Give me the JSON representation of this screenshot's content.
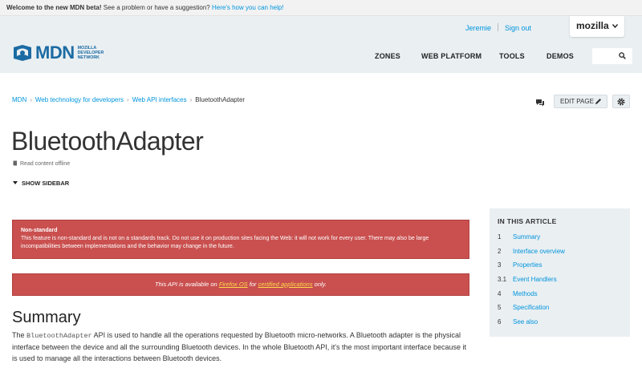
{
  "beta_bar": {
    "welcome": "Welcome to the new MDN beta!",
    "prompt": "See a problem or have a suggestion?",
    "link": "Here's how you can help!"
  },
  "header": {
    "logo_text": "MDN",
    "logo_subtitle": [
      "MOZILLA",
      "DEVELOPER",
      "NETWORK"
    ],
    "user": "Jeremie",
    "sign_out": "Sign out",
    "mozilla_tab": "mozilla",
    "nav": [
      {
        "label": "ZONES"
      },
      {
        "label": "WEB PLATFORM"
      },
      {
        "label": "TOOLS"
      },
      {
        "label": "DEMOS"
      }
    ],
    "search_placeholder": ""
  },
  "breadcrumb": {
    "items": [
      "MDN",
      "Web technology for developers",
      "Web API interfaces"
    ],
    "current": "BluetoothAdapter"
  },
  "actions": {
    "edit_label": "EDIT PAGE"
  },
  "page": {
    "title": "BluetoothAdapter",
    "offline_label": "Read content offline",
    "sidebar_toggle": "SHOW SIDEBAR"
  },
  "notice": {
    "title": "Non-standard",
    "body": "This feature is non-standard and is not on a standards track. Do not use it on production sites facing the Web: it will not work for every user. There may also be large incompatibilities between implementations and the behavior may change in the future."
  },
  "firefox_notice": {
    "pre": "This API is available on",
    "link1": "Firefox OS",
    "mid": "for",
    "link2": "certified applications",
    "post": "only."
  },
  "summary": {
    "heading": "Summary",
    "text_pre": "The",
    "code": "BluetoothAdapter",
    "text_post": "API is used to handle all the operations requested by Bluetooth micro-networks. A Bluetooth adapter is the physical interface between the device and all the surrounding Bluetooth devices. In the whole Bluetooth API, it's the most important interface because it is used to manage all the interactions between Bluetooth devices."
  },
  "toc": {
    "title": "IN THIS ARTICLE",
    "items": [
      {
        "num": "1",
        "label": "Summary"
      },
      {
        "num": "2",
        "label": "Interface overview"
      },
      {
        "num": "3",
        "label": "Properties"
      },
      {
        "num": "3.1",
        "label": "Event Handlers"
      },
      {
        "num": "4",
        "label": "Methods"
      },
      {
        "num": "5",
        "label": "Specification"
      },
      {
        "num": "6",
        "label": "See also"
      }
    ]
  },
  "colors": {
    "accent": "#0095dd",
    "notice_red": "#c9504f",
    "header_bg": "#eaeff2",
    "link_yellow": "#ffd94a"
  },
  "icons": [
    "mdn-logo-icon",
    "chevron-down-icon",
    "search-icon",
    "comment-icon",
    "pencil-icon",
    "gear-icon",
    "book-icon",
    "triangle-down-icon"
  ]
}
